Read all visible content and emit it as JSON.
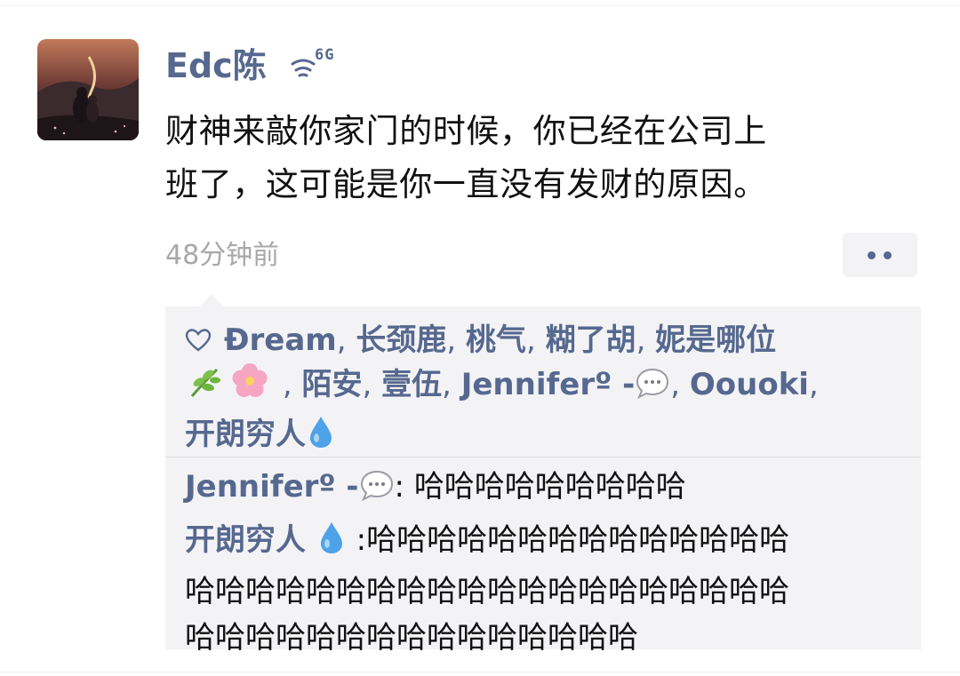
{
  "post": {
    "username": "Edc陈",
    "network_label": "6G",
    "text_lines": [
      "财神来敲你家门的时候，你已经在公司上",
      "班了，这可能是你一直没有发财的原因。"
    ],
    "timestamp": "48分钟前"
  },
  "likes": {
    "names": [
      "Đream",
      "长颈鹿",
      "桃气",
      "糊了胡",
      "妮是哪位",
      "陌安",
      "壹伍",
      "Jenniferº -",
      "Oouoki",
      "开朗穷人"
    ],
    "separator": ", "
  },
  "comments": [
    {
      "author": "Jenniferº -",
      "colon": ":",
      "lines": [
        "哈哈哈哈哈哈哈哈哈"
      ]
    },
    {
      "author": "开朗穷人",
      "colon": ":",
      "lines": [
        "哈哈哈哈哈哈哈哈哈哈哈哈哈哈",
        "哈哈哈哈哈哈哈哈哈哈哈哈哈哈哈哈哈哈哈哈",
        "哈哈哈哈哈哈哈哈哈哈哈哈哈哈哈"
      ]
    }
  ],
  "icons": {
    "like": "heart-outline-icon",
    "more": "more-dots-icon",
    "network": "wifi-icon",
    "emoji_leaf": "herb-emoji",
    "emoji_flower": "cherry-blossom-emoji",
    "emoji_bubble": "speech-bubble-emoji",
    "emoji_drop": "droplet-emoji"
  },
  "colors": {
    "link": "#56688f",
    "text": "#111111",
    "muted": "#a8a8a8",
    "panel": "#f3f3f5"
  }
}
